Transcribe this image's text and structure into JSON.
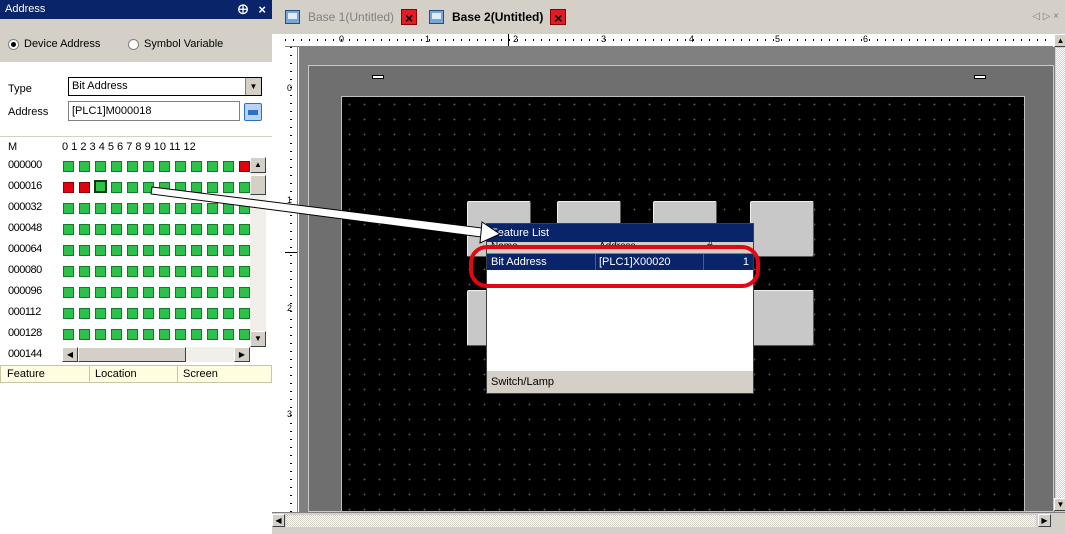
{
  "address_panel": {
    "title": "Address",
    "pin_glyph": "⨁",
    "close_glyph": "×",
    "mode": {
      "device_label": "Device Address",
      "symbol_label": "Symbol Variable",
      "selected": "device"
    },
    "type_label": "Type",
    "type_value": "Bit Address",
    "address_label": "Address",
    "address_value": "[PLC1]M000018",
    "grid": {
      "device_letter": "M",
      "column_labels": "0 1 2 3 4 5 6 7 8 9 10 11 12",
      "row_labels": [
        "000000",
        "000016",
        "000032",
        "000048",
        "000064",
        "000080",
        "000096",
        "000112",
        "000128",
        "000144"
      ]
    },
    "feature_columns": [
      "Feature",
      "Location",
      "Screen"
    ]
  },
  "tabs": [
    {
      "label": "Base 1(Untitled)",
      "active": false
    },
    {
      "label": "Base 2(Untitled)",
      "active": true
    }
  ],
  "tab_nav": "◁ ▷ ×",
  "rulers": {
    "h_labels": [
      "0",
      "1",
      "2",
      "3",
      "4",
      "5",
      "6"
    ],
    "v_labels": [
      "0",
      "1",
      "2",
      "3"
    ]
  },
  "feature_list": {
    "title": "Feature List",
    "columns": [
      "Name",
      "Address",
      "#"
    ],
    "row": {
      "name": "Bit Address",
      "address": "[PLC1]X00020",
      "count": "1"
    },
    "footer": "Switch/Lamp"
  },
  "icons": {
    "tab_icon": "screen-icon",
    "close_tab": "close-icon",
    "input_button": "keypad-icon"
  },
  "colors": {
    "title_bar": "#0a246a",
    "bit_on": "#e3000f",
    "bit_off": "#2cc24a",
    "highlight": "#e30613"
  }
}
